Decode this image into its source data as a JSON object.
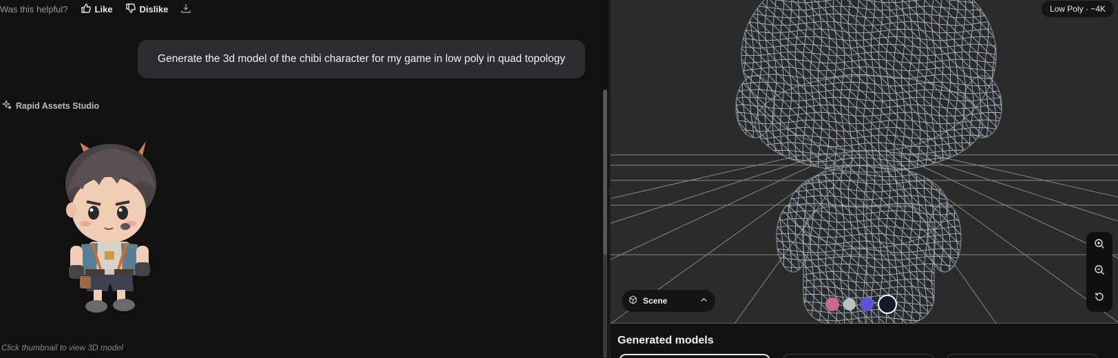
{
  "feedback": {
    "question": "Was this helpful?",
    "like_label": "Like",
    "dislike_label": "Dislike",
    "download_icon": "download-icon"
  },
  "user_message": {
    "text": "Generate the 3d model of the chibi character for my game in low poly in quad topology"
  },
  "assistant": {
    "name": "Rapid Assets Studio",
    "icon": "sparkle-icon",
    "hint": "Click thumbnail to view 3D model"
  },
  "viewer": {
    "badge": "Low Poly · ~4K",
    "scene_label": "Scene",
    "zoom_in_icon": "zoom-in-icon",
    "zoom_out_icon": "zoom-out-icon",
    "reset_icon": "reset-icon",
    "materials": [
      {
        "name": "color-material",
        "color": "#c86a8c"
      },
      {
        "name": "clay-material",
        "color": "#bfbfbf"
      },
      {
        "name": "normal-material",
        "color": "#5b54d6"
      },
      {
        "name": "wireframe-material",
        "color": "#15182e",
        "selected": true
      }
    ],
    "wire_color": "#a9b8c9",
    "grid_color": "#8a8a8a",
    "background": "#2b2b2b"
  },
  "generated_models": {
    "title": "Generated models",
    "cards": [
      {
        "selected": true
      },
      {
        "selected": false
      },
      {
        "selected": false
      }
    ]
  },
  "colors": {
    "app_bg": "#111111",
    "bubble_bg": "#2d2d31",
    "panel_bg": "#121212"
  }
}
